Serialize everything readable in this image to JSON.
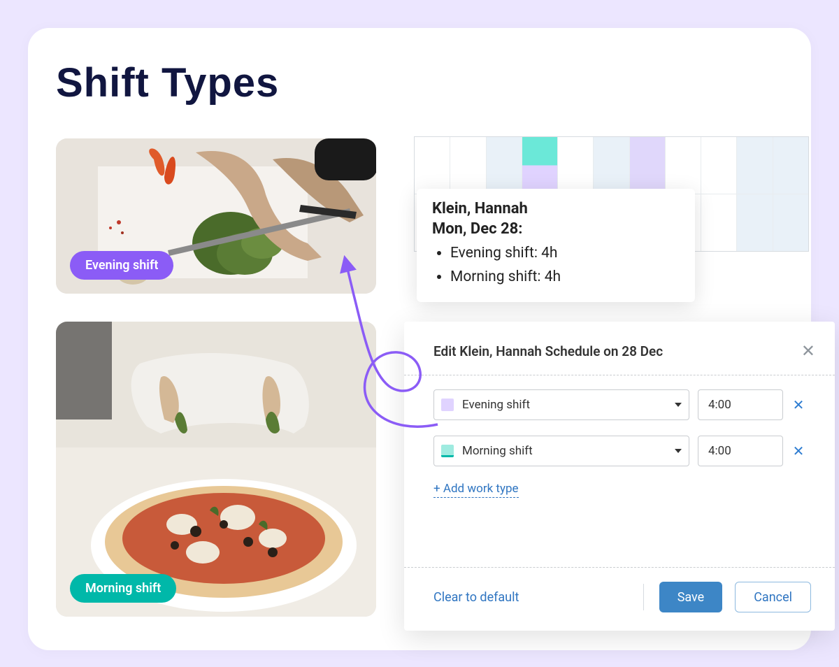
{
  "page": {
    "title": "Shift Types"
  },
  "badges": {
    "evening": "Evening shift",
    "morning": "Morning shift"
  },
  "popover": {
    "name": "Klein, Hannah",
    "date": "Mon, Dec 28:",
    "items": [
      "Evening shift: 4h",
      "Morning shift: 4h"
    ]
  },
  "dialog": {
    "title": "Edit Klein, Hannah Schedule on 28 Dec",
    "rows": [
      {
        "type": "Evening shift",
        "time": "4:00",
        "color": "purple"
      },
      {
        "type": "Morning shift",
        "time": "4:00",
        "color": "teal"
      }
    ],
    "add_label": "+ Add work type",
    "clear_label": "Clear to default",
    "save_label": "Save",
    "cancel_label": "Cancel"
  },
  "colors": {
    "evening_badge": "#8b5cf6",
    "morning_badge": "#00b8a9",
    "link": "#2f75c1"
  }
}
